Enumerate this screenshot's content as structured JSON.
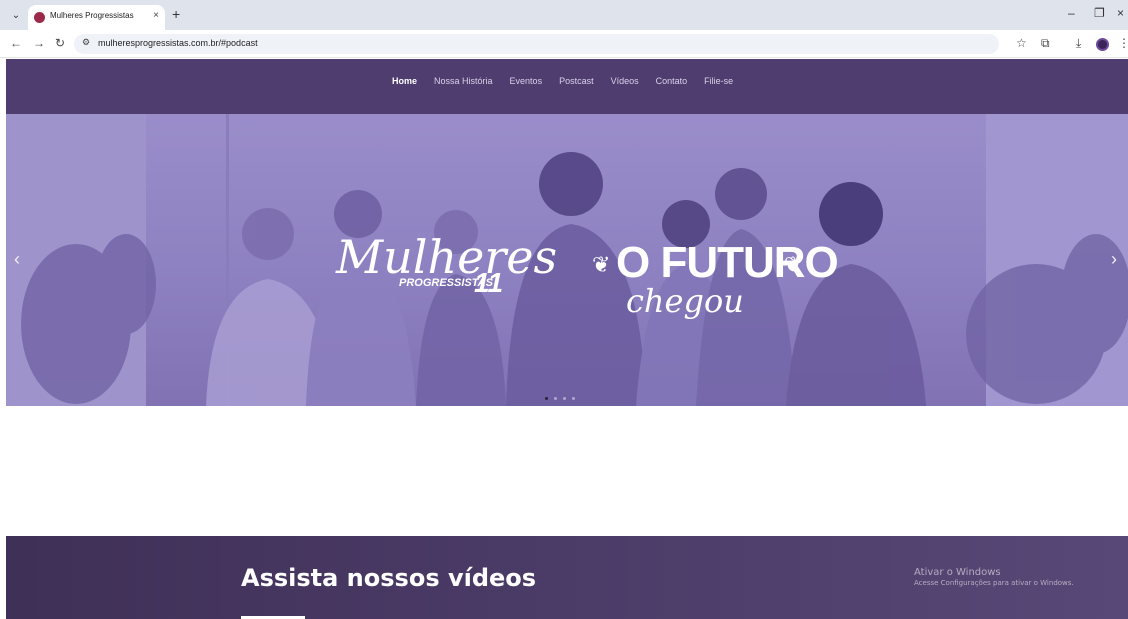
{
  "browser": {
    "tab_title": "Mulheres Progressistas",
    "tab_close": "×",
    "new_tab": "+",
    "tab_menu": "⌄",
    "url": "mulheresprogressistas.com.br/#podcast",
    "controls": {
      "minimize": "–",
      "maximize": "❐",
      "close": "×"
    },
    "nav": {
      "back": "←",
      "forward": "→",
      "reload": "↻",
      "site_info": "⚙"
    },
    "toolbar_icons": {
      "bookmark": "☆",
      "extensions": "⧉",
      "downloads": "⤓",
      "menu": "⋮"
    }
  },
  "site_nav": {
    "items": [
      {
        "label": "Home",
        "active": true
      },
      {
        "label": "Nossa História",
        "active": false
      },
      {
        "label": "Eventos",
        "active": false
      },
      {
        "label": "Postcast",
        "active": false
      },
      {
        "label": "Vídeos",
        "active": false
      },
      {
        "label": "Contato",
        "active": false
      },
      {
        "label": "Filie-se",
        "active": false
      }
    ]
  },
  "hero": {
    "logo_script": "Mulheres",
    "logo_sub": "PROGRESSISTAS",
    "logo_number": "11",
    "headline": "O FUTURO",
    "headline_script": "chegou",
    "prev_arrow": "‹",
    "next_arrow": "›",
    "slide_count": 4,
    "active_slide": 1
  },
  "videos_section": {
    "title": "Assista nossos vídeos"
  },
  "watermark": {
    "line1": "Ativar o Windows",
    "line2": "Acesse Configurações para ativar o Windows."
  },
  "colors": {
    "nav_bg": "#4e3d6e",
    "hero_tint": "#9a8dca",
    "section_bg": "#4a3a66",
    "favicon": "#9b2a48"
  }
}
